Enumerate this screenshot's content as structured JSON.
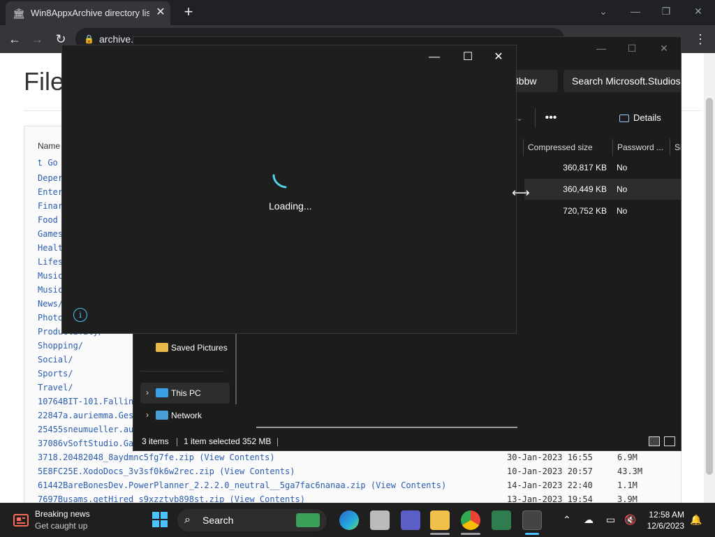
{
  "browser": {
    "tab_title": "Win8AppxArchive directory listin",
    "tab_close": "✕",
    "new_tab": "+",
    "url": "archive.",
    "window_controls": [
      "⌄",
      "—",
      "❐",
      "✕"
    ]
  },
  "page": {
    "heading": "File",
    "column_name": "Name",
    "parent_link": "Go",
    "dir_links": [
      "Deper",
      "Enter",
      "Finar",
      "Food",
      "Games",
      "Healt",
      "Lifes",
      "Music",
      "Music",
      "News/",
      "Photo",
      "Productivity/",
      "Shopping/",
      "Social/",
      "Sports/",
      "Travel/"
    ],
    "file_links_partial": [
      "10764BIT-101.Fallin",
      "22847a.auriemma.Ges",
      "25455sneumueller.au",
      "37086vSoftStudio.Ga"
    ],
    "files": [
      {
        "name": "3718.20482048_8aydmnc5fg7fe.zip",
        "view": "View Contents",
        "date": "30-Jan-2023 16:55",
        "size": "6.9M"
      },
      {
        "name": "5E8FC25E.XodoDocs_3v3sf0k6w2rec.zip",
        "view": "View Contents",
        "date": "10-Jan-2023 20:57",
        "size": "43.3M"
      },
      {
        "name": "61442BareBonesDev.PowerPlanner_2.2.2.0_neutral__5ga7fac6nanaa.zip",
        "view": "View Contents",
        "date": "14-Jan-2023 22:40",
        "size": "1.1M"
      },
      {
        "name": "7697Busams.getHired_s9xzztvb898st.zip",
        "view": "View Contents",
        "date": "13-Jan-2023 19:54",
        "size": "3.9M"
      }
    ]
  },
  "explorer": {
    "path_tail": "3bbw",
    "search_placeholder": "Search Microsoft.Studios.",
    "more": "•••",
    "details_label": "Details",
    "columns": [
      "Compressed size",
      "Password ...",
      "Si"
    ],
    "rows": [
      {
        "compressed": "360,817 KB",
        "password": "No"
      },
      {
        "compressed": "360,449 KB",
        "password": "No"
      },
      {
        "compressed": "720,752 KB",
        "password": "No"
      }
    ],
    "nav": {
      "saved_pictures": "Saved Pictures",
      "this_pc": "This PC",
      "network": "Network"
    },
    "status": {
      "items": "3 items",
      "selected": "1 item selected",
      "size": "352 MB"
    }
  },
  "dialog": {
    "loading": "Loading...",
    "info": "i",
    "controls": [
      "—",
      "☐",
      "✕"
    ]
  },
  "taskbar": {
    "news_title": "Breaking news",
    "news_sub": "Get caught up",
    "search_label": "Search",
    "time": "12:58 AM",
    "date": "12/6/2023"
  }
}
